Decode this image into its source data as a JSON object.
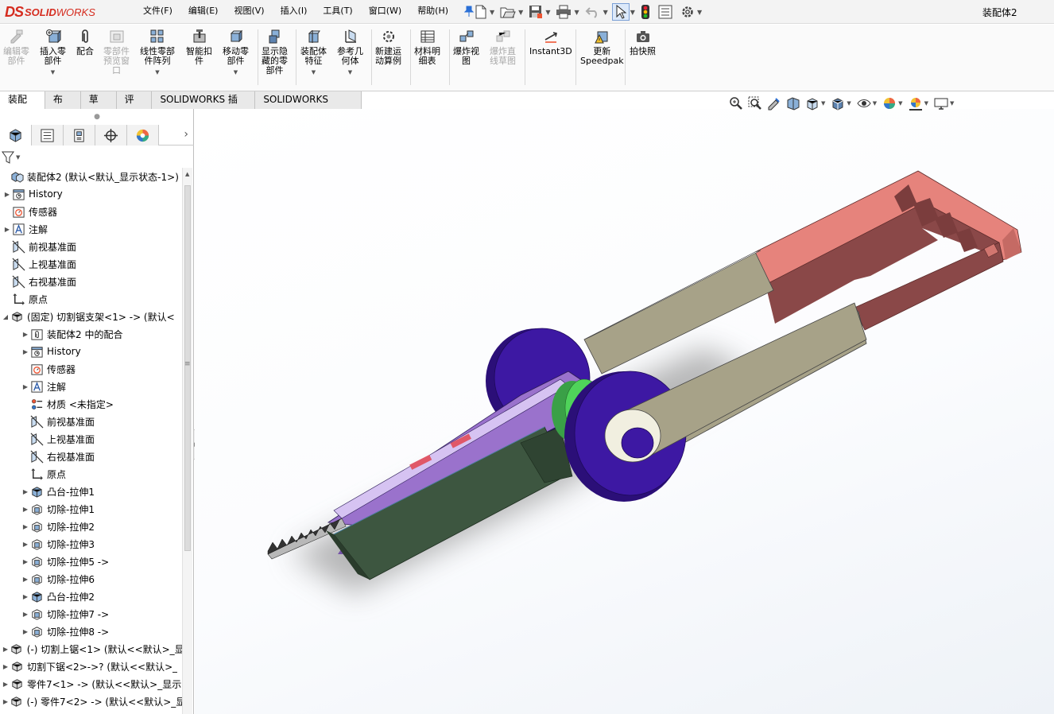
{
  "app": {
    "brand_ds": "DS",
    "brand_solid": "SOLID",
    "brand_works": "WORKS",
    "document_title": "装配体2"
  },
  "menus": [
    "文件(F)",
    "编辑(E)",
    "视图(V)",
    "插入(I)",
    "工具(T)",
    "窗口(W)",
    "帮助(H)"
  ],
  "quick_access": [
    "new-document-icon",
    "open-icon",
    "save-icon",
    "print-icon",
    "undo-icon",
    "select-icon",
    "rebuild-icon",
    "file-properties-icon",
    "options-icon"
  ],
  "command_manager": {
    "edit_component": "编辑零\n部件",
    "insert_components": "插入零\n部件",
    "mate": "配合",
    "component_preview": "零部件\n预览窗\n口",
    "linear_pattern": "线性零部\n件阵列",
    "smart_fasteners": "智能扣\n件",
    "move_component": "移动零\n部件",
    "show_hidden": "显示隐\n藏的零\n部件",
    "assembly_features": "装配体\n特征",
    "reference_geometry": "参考几\n何体",
    "new_motion_study": "新建运\n动算例",
    "bill_of_materials": "材料明\n细表",
    "exploded_view": "爆炸视\n图",
    "explode_line_sketch": "爆炸直\n线草图",
    "instant3d": "Instant3D",
    "update_speedpak": "更新\nSpeedpak",
    "take_snapshot": "拍快照"
  },
  "tabs": [
    "装配体",
    "布局",
    "草图",
    "评估",
    "SOLIDWORKS 插件",
    "SOLIDWORKS MBD"
  ],
  "active_tab": "装配体",
  "view_toolbar": [
    "zoom-to-fit-icon",
    "zoom-area-icon",
    "previous-view-icon",
    "section-view-icon",
    "view-orientation-icon",
    "display-style-icon",
    "hide-show-icon",
    "edit-appearance-icon",
    "apply-scene-icon",
    "view-settings-icon"
  ],
  "tree": {
    "root": "装配体2  (默认<默认_显示状态-1>)",
    "items": [
      {
        "label": "History",
        "level": 1,
        "expand": true,
        "icon": "history"
      },
      {
        "label": "传感器",
        "level": 1,
        "expand": false,
        "icon": "sensor"
      },
      {
        "label": "注解",
        "level": 1,
        "expand": true,
        "icon": "annotation"
      },
      {
        "label": "前视基准面",
        "level": 1,
        "expand": false,
        "icon": "plane"
      },
      {
        "label": "上视基准面",
        "level": 1,
        "expand": false,
        "icon": "plane"
      },
      {
        "label": "右视基准面",
        "level": 1,
        "expand": false,
        "icon": "plane"
      },
      {
        "label": "原点",
        "level": 1,
        "expand": false,
        "icon": "origin"
      },
      {
        "label": "(固定) 切割锯支架<1> -> (默认<",
        "level": 0,
        "expand": "open",
        "icon": "part"
      },
      {
        "label": "装配体2 中的配合",
        "level": 2,
        "expand": true,
        "icon": "mates"
      },
      {
        "label": "History",
        "level": 2,
        "expand": true,
        "icon": "history"
      },
      {
        "label": "传感器",
        "level": 2,
        "expand": false,
        "icon": "sensor"
      },
      {
        "label": "注解",
        "level": 2,
        "expand": true,
        "icon": "annotation"
      },
      {
        "label": "材质 <未指定>",
        "level": 2,
        "expand": false,
        "icon": "material"
      },
      {
        "label": "前视基准面",
        "level": 2,
        "expand": false,
        "icon": "plane"
      },
      {
        "label": "上视基准面",
        "level": 2,
        "expand": false,
        "icon": "plane"
      },
      {
        "label": "右视基准面",
        "level": 2,
        "expand": false,
        "icon": "plane"
      },
      {
        "label": "原点",
        "level": 2,
        "expand": false,
        "icon": "origin"
      },
      {
        "label": "凸台-拉伸1",
        "level": 2,
        "expand": true,
        "icon": "boss"
      },
      {
        "label": "切除-拉伸1",
        "level": 2,
        "expand": true,
        "icon": "cut"
      },
      {
        "label": "切除-拉伸2",
        "level": 2,
        "expand": true,
        "icon": "cut"
      },
      {
        "label": "切除-拉伸3",
        "level": 2,
        "expand": true,
        "icon": "cut"
      },
      {
        "label": "切除-拉伸5 ->",
        "level": 2,
        "expand": true,
        "icon": "cut"
      },
      {
        "label": "切除-拉伸6",
        "level": 2,
        "expand": true,
        "icon": "cut"
      },
      {
        "label": "凸台-拉伸2",
        "level": 2,
        "expand": true,
        "icon": "boss"
      },
      {
        "label": "切除-拉伸7 ->",
        "level": 2,
        "expand": true,
        "icon": "cut"
      },
      {
        "label": "切除-拉伸8 ->",
        "level": 2,
        "expand": true,
        "icon": "cut"
      },
      {
        "label": "(-) 切割上锯<1> (默认<<默认>_显",
        "level": 0,
        "expand": true,
        "icon": "part"
      },
      {
        "label": "切割下锯<2>->? (默认<<默认>_",
        "level": 0,
        "expand": true,
        "icon": "part"
      },
      {
        "label": "零件7<1> -> (默认<<默认>_显示",
        "level": 0,
        "expand": true,
        "icon": "part"
      },
      {
        "label": "(-) 零件7<2> -> (默认<<默认>_显",
        "level": 0,
        "expand": true,
        "icon": "part"
      }
    ]
  },
  "colors": {
    "accent": "#d52b1e",
    "frame_pink": "#e6837c",
    "frame_dark": "#8a4848",
    "arm_khaki": "#a7a288",
    "wheel_purple": "#3d18a3",
    "body_lavender": "#9a72cc",
    "housing_green": "#3d5640",
    "hub_green": "#4fd35a"
  }
}
